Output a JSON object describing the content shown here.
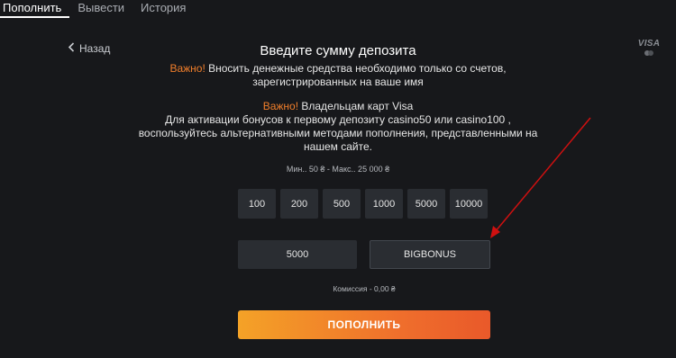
{
  "tabs": [
    {
      "label": "Пополнить",
      "active": true
    },
    {
      "label": "Вывести",
      "active": false
    },
    {
      "label": "История",
      "active": false
    }
  ],
  "back": {
    "label": "Назад",
    "icon": "chevron-left-icon"
  },
  "payment_brand": {
    "label": "VISA",
    "secondary_icon": "mastercard-icon"
  },
  "title": "Введите сумму депозита",
  "notice1": {
    "important": "Важно!",
    "text": " Вносить денежные средства необходимо только со счетов, зарегистрированных на ваше имя"
  },
  "notice2": {
    "important": "Важно!",
    "line1": " Владельцам карт Visa",
    "line2": "Для активации бонусов к первому депозиту casino50 или casino100 , воспользуйтесь альтернативными методами пополнения, представленными на нашем сайте."
  },
  "limits": "Мин.. 50 ₴ - Макс.. 25 000 ₴",
  "amount_options": [
    "100",
    "200",
    "500",
    "1000",
    "5000",
    "10000"
  ],
  "amount_field": {
    "value": "5000"
  },
  "promo_field": {
    "value": "BIGBONUS"
  },
  "fee": "Комиссия - 0,00 ₴",
  "submit_label": "ПОПОЛНИТЬ",
  "colors": {
    "accent": "#f07e2b",
    "button_start": "#f4a227",
    "button_end": "#e9592a",
    "arrow": "#d01010",
    "background": "#17181b"
  }
}
